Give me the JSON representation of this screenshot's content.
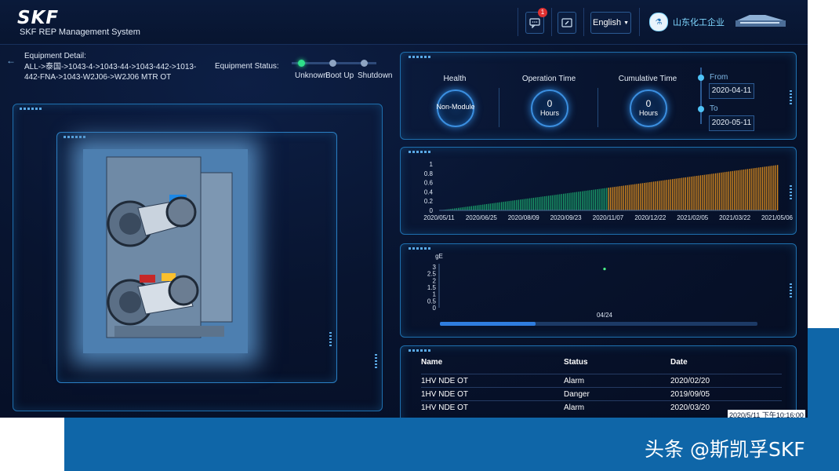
{
  "app": {
    "logo": "SKF",
    "subtitle": "SKF REP Management System",
    "language": "English",
    "notification_count": "1",
    "company_name": "山东化工企业"
  },
  "equipment": {
    "detail_label": "Equipment Detail:",
    "path": "ALL->泰国->1043-4->1043-44->1043-442->1013-442-FNA->1043-W2J06->W2J06 MTR OT",
    "status_label": "Equipment Status:",
    "status_steps": [
      {
        "label": "Unknown",
        "active": true
      },
      {
        "label": "Boot Up",
        "active": false
      },
      {
        "label": "Shutdown",
        "active": false
      }
    ]
  },
  "gauges": {
    "health": {
      "title": "Health",
      "value": "Non-Module"
    },
    "operation": {
      "title": "Operation Time",
      "value": "0",
      "unit": "Hours"
    },
    "cumulative": {
      "title": "Cumulative Time",
      "value": "0",
      "unit": "Hours"
    }
  },
  "date_range": {
    "from_label": "From",
    "from": "2020-04-11",
    "to_label": "To",
    "to": "2020-05-11"
  },
  "chart_data": [
    {
      "type": "bar",
      "x_ticks": [
        "2020/05/11",
        "2020/06/25",
        "2020/08/09",
        "2020/09/23",
        "2020/11/07",
        "2020/12/22",
        "2021/02/05",
        "2021/03/22",
        "2021/05/06"
      ],
      "y_ticks": [
        "0",
        "0.2",
        "0.4",
        "0.6",
        "0.8",
        "1"
      ],
      "ylim": [
        0,
        1
      ],
      "xlim": [
        "2020/05/11",
        "2021/05/06"
      ],
      "series": [
        {
          "x": [
            "2020/05/11",
            "2020/11/07"
          ],
          "y": [
            0,
            0.49
          ],
          "color": "#1a9e6a"
        },
        {
          "x": [
            "2020/11/07",
            "2021/05/06"
          ],
          "y": [
            0.49,
            0.98
          ],
          "color": "#d88a1e"
        }
      ]
    },
    {
      "type": "scatter",
      "ylabel": "gE",
      "y_ticks": [
        "0",
        "0.5",
        "1",
        "1.5",
        "2",
        "2.5",
        "3"
      ],
      "ylim": [
        0,
        3
      ],
      "x_label": "04/24",
      "points": [
        {
          "x": "04/24",
          "y": 2.85
        }
      ],
      "point_color": "#4cff8a"
    }
  ],
  "alarm_table": {
    "headers": [
      "Name",
      "Status",
      "Date"
    ],
    "rows": [
      [
        "1HV NDE OT",
        "Alarm",
        "2020/02/20"
      ],
      [
        "1HV NDE OT",
        "Danger",
        "2019/09/05"
      ],
      [
        "1HV NDE OT",
        "Alarm",
        "2020/03/20"
      ]
    ]
  },
  "footer": {
    "timestamp": "2020/5/11 下午10:16:00",
    "watermark": "头条 @斯凯孚SKF"
  },
  "colors": {
    "accent": "#1e6fae",
    "background": "#08142f",
    "brand_blue": "#0f66a8"
  }
}
